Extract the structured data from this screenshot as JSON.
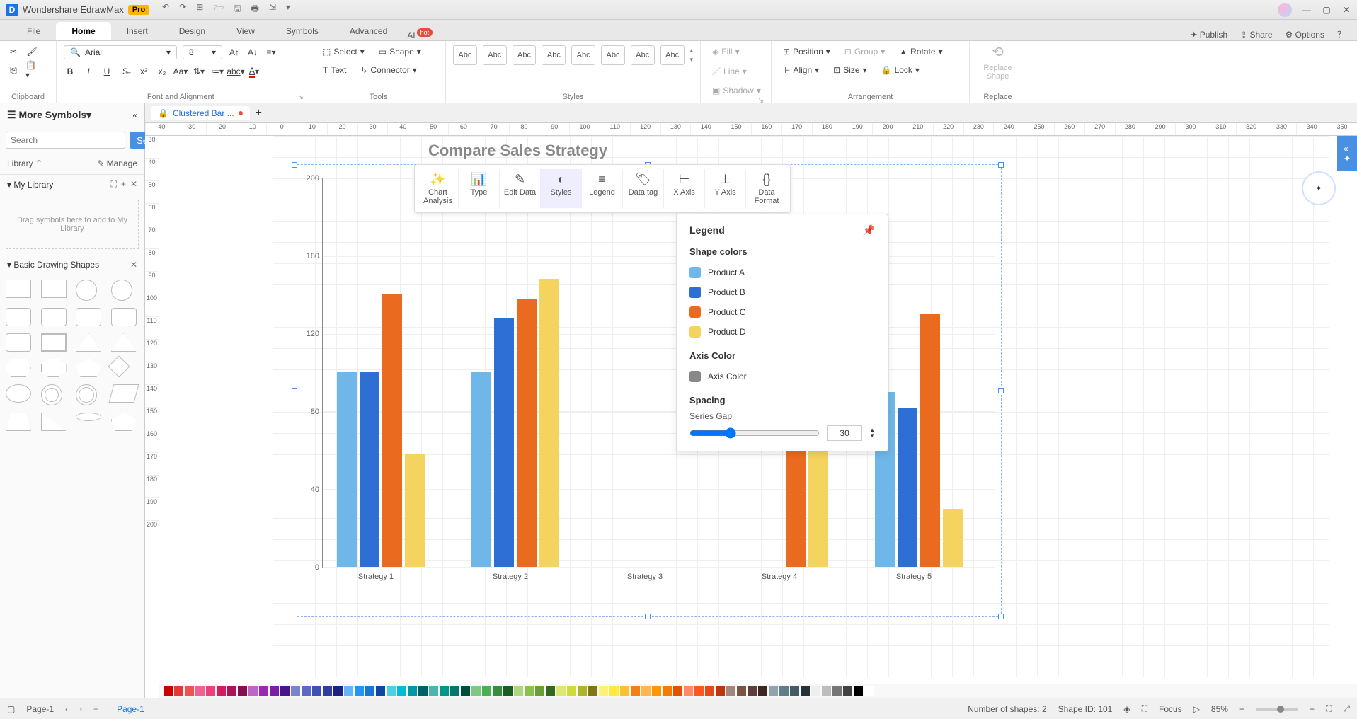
{
  "app": {
    "name": "Wondershare EdrawMax",
    "badge": "Pro"
  },
  "menus": [
    "File",
    "Home",
    "Insert",
    "Design",
    "View",
    "Symbols",
    "Advanced"
  ],
  "active_menu": "Home",
  "ai_label": "AI",
  "hot_label": "hot",
  "rightmenu": {
    "publish": "Publish",
    "share": "Share",
    "options": "Options"
  },
  "ribbon": {
    "clipboard": "Clipboard",
    "font_name": "Arial",
    "font_size": "8",
    "fontalign": "Font and Alignment",
    "select": "Select",
    "shape": "Shape",
    "text": "Text",
    "connector": "Connector",
    "tools": "Tools",
    "style_label": "Abc",
    "styles": "Styles",
    "fill": "Fill",
    "line": "Line",
    "shadow": "Shadow",
    "position": "Position",
    "group": "Group",
    "rotate": "Rotate",
    "align": "Align",
    "size": "Size",
    "lock": "Lock",
    "arrangement": "Arrangement",
    "replace_shape": "Replace\nShape",
    "replace": "Replace"
  },
  "sidebar": {
    "more_symbols": "More Symbols",
    "search_ph": "Search",
    "search_btn": "Search",
    "library": "Library",
    "manage": "Manage",
    "mylib": "My Library",
    "dropzone": "Drag symbols here to add to My Library",
    "basic": "Basic Drawing Shapes"
  },
  "doctab": "Clustered Bar ...",
  "hruler": [
    "-40",
    "-30",
    "-20",
    "-10",
    "0",
    "10",
    "20",
    "30",
    "40",
    "50",
    "60",
    "70",
    "80",
    "90",
    "100",
    "110",
    "120",
    "130",
    "140",
    "150",
    "160",
    "170",
    "180",
    "190",
    "200",
    "210",
    "220",
    "230",
    "240",
    "250",
    "260",
    "270",
    "280",
    "290",
    "300",
    "310",
    "320",
    "330",
    "340",
    "350"
  ],
  "vruler": [
    "30",
    "40",
    "50",
    "60",
    "70",
    "80",
    "90",
    "100",
    "110",
    "120",
    "130",
    "140",
    "150",
    "160",
    "170",
    "180",
    "190",
    "200"
  ],
  "chart_toolbar": [
    "Chart Analysis",
    "Type",
    "Edit Data",
    "Styles",
    "Legend",
    "Data tag",
    "X Axis",
    "Y Axis",
    "Data Format"
  ],
  "chart_toolbar_active": 3,
  "legend_panel": {
    "title": "Legend",
    "shape_colors": "Shape colors",
    "items": [
      {
        "name": "Product A",
        "color": "#6fb7e8"
      },
      {
        "name": "Product B",
        "color": "#2e6fd6"
      },
      {
        "name": "Product C",
        "color": "#ea6a1f"
      },
      {
        "name": "Product D",
        "color": "#f4d35e"
      }
    ],
    "axis_color_label": "Axis Color",
    "axis_color_item": "Axis Color",
    "axis_color": "#888888",
    "spacing": "Spacing",
    "series_gap": "Series Gap",
    "gap_value": "30"
  },
  "pages": {
    "label": "Page-1",
    "tab": "Page-1"
  },
  "status": {
    "shapes": "Number of shapes: 2",
    "shapeid": "Shape ID: 101",
    "focus": "Focus",
    "zoom": "85%"
  },
  "chart_data": {
    "type": "bar",
    "title": "Compare Sales Strategy",
    "xlabel": "",
    "ylabel": "",
    "ylim": [
      0,
      200
    ],
    "yticks": [
      0,
      40,
      80,
      120,
      160,
      200
    ],
    "categories": [
      "Strategy 1",
      "Strategy 2",
      "Strategy 3",
      "Strategy 4",
      "Strategy 5"
    ],
    "series": [
      {
        "name": "Product A",
        "color": "#6fb7e8",
        "values": [
          100,
          100,
          null,
          null,
          90
        ]
      },
      {
        "name": "Product B",
        "color": "#2e6fd6",
        "values": [
          100,
          128,
          null,
          null,
          82
        ]
      },
      {
        "name": "Product C",
        "color": "#ea6a1f",
        "values": [
          140,
          138,
          null,
          142,
          130
        ]
      },
      {
        "name": "Product D",
        "color": "#f4d35e",
        "values": [
          58,
          148,
          null,
          148,
          30
        ]
      }
    ]
  },
  "colorbar": [
    "#cc0000",
    "#e53935",
    "#ef5350",
    "#f06292",
    "#ec407a",
    "#d81b60",
    "#ad1457",
    "#880e4f",
    "#ba68c8",
    "#9c27b0",
    "#7b1fa2",
    "#4a148c",
    "#7986cb",
    "#5c6bc0",
    "#3f51b5",
    "#303f9f",
    "#1a237e",
    "#64b5f6",
    "#2196f3",
    "#1976d2",
    "#0d47a1",
    "#4dd0e1",
    "#00bcd4",
    "#0097a7",
    "#006064",
    "#4db6ac",
    "#009688",
    "#00796b",
    "#004d40",
    "#81c784",
    "#4caf50",
    "#388e3c",
    "#1b5e20",
    "#aed581",
    "#8bc34a",
    "#689f38",
    "#33691e",
    "#dce775",
    "#cddc39",
    "#afb42b",
    "#827717",
    "#fff176",
    "#ffeb3b",
    "#fbc02d",
    "#f57f17",
    "#ffb74d",
    "#ff9800",
    "#f57c00",
    "#e65100",
    "#ff8a65",
    "#ff5722",
    "#e64a19",
    "#bf360c",
    "#a1887f",
    "#795548",
    "#5d4037",
    "#3e2723",
    "#90a4ae",
    "#607d8b",
    "#455a64",
    "#263238",
    "#eeeeee",
    "#bdbdbd",
    "#757575",
    "#424242",
    "#000000",
    "#ffffff"
  ]
}
